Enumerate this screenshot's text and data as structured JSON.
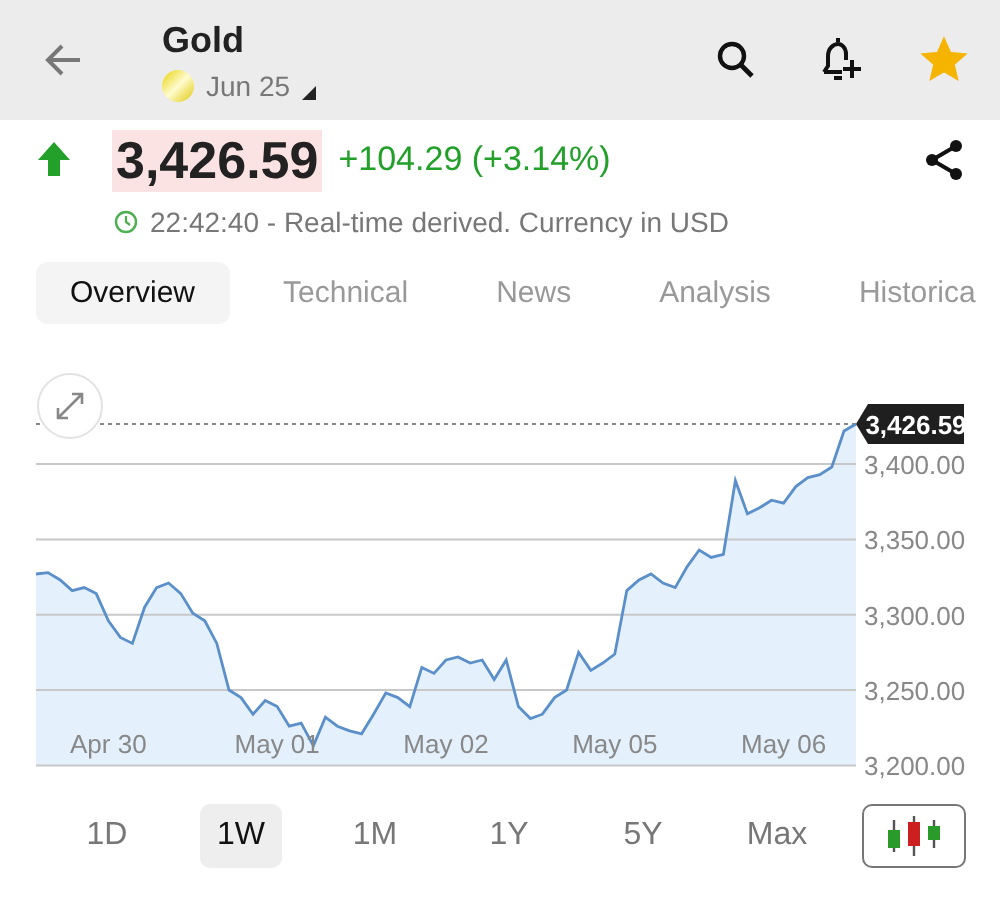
{
  "header": {
    "title": "Gold",
    "subtitle": "Jun 25",
    "starred": true
  },
  "quote": {
    "rising": true,
    "price": "3,426.59",
    "change": "+104.29 (+3.14%)",
    "time": "22:42:40 - Real-time derived. Currency in USD"
  },
  "tabs": [
    {
      "label": "Overview",
      "selected": true
    },
    {
      "label": "Technical",
      "selected": false
    },
    {
      "label": "News",
      "selected": false
    },
    {
      "label": "Analysis",
      "selected": false
    },
    {
      "label": "Historica",
      "selected": false
    }
  ],
  "chart": {
    "chart_data": {
      "type": "area",
      "grid": true,
      "ylim": [
        3200,
        3426.59
      ],
      "yticks": [
        {
          "value": 3200,
          "label": "3,200.00"
        },
        {
          "value": 3250,
          "label": "3,250.00"
        },
        {
          "value": 3300,
          "label": "3,300.00"
        },
        {
          "value": 3350,
          "label": "3,350.00"
        },
        {
          "value": 3400,
          "label": "3,400.00"
        }
      ],
      "categories": [
        null,
        null,
        null,
        null,
        null,
        null,
        "Apr 30",
        null,
        null,
        null,
        null,
        null,
        null,
        null,
        null,
        null,
        null,
        null,
        null,
        null,
        "May 01",
        null,
        null,
        null,
        null,
        null,
        null,
        null,
        null,
        null,
        null,
        null,
        null,
        null,
        "May 02",
        null,
        null,
        null,
        null,
        null,
        null,
        null,
        null,
        null,
        null,
        null,
        null,
        null,
        "May 05",
        null,
        null,
        null,
        null,
        null,
        null,
        null,
        null,
        null,
        null,
        null,
        null,
        null,
        "May 06",
        null,
        null,
        null,
        null,
        null,
        null
      ],
      "series": [
        {
          "color": "#5b8fc9",
          "values": [
            3327,
            3328,
            3323,
            3316,
            3318,
            3314,
            3296,
            3285,
            3281,
            3305,
            3318,
            3321,
            3314,
            3301,
            3296,
            3281,
            3250,
            3245,
            3234,
            3243,
            3239,
            3226,
            3228,
            3213,
            3232,
            3226,
            3223,
            3221,
            3234,
            3248,
            3245,
            3239,
            3265,
            3261,
            3270,
            3272,
            3268,
            3270,
            3257,
            3270,
            3239,
            3231,
            3234,
            3245,
            3250,
            3275,
            3263,
            3268,
            3274,
            3316,
            3323,
            3327,
            3321,
            3318,
            3332,
            3343,
            3338,
            3340,
            3389,
            3367,
            3371,
            3376,
            3374,
            3385,
            3391,
            3393,
            3398,
            3422,
            3426.59
          ]
        }
      ],
      "annotations": [
        "3,426.59"
      ]
    }
  },
  "ranges": [
    {
      "label": "1D",
      "selected": false
    },
    {
      "label": "1W",
      "selected": true
    },
    {
      "label": "1M",
      "selected": false
    },
    {
      "label": "1Y",
      "selected": false
    },
    {
      "label": "5Y",
      "selected": false
    },
    {
      "label": "Max",
      "selected": false
    }
  ]
}
